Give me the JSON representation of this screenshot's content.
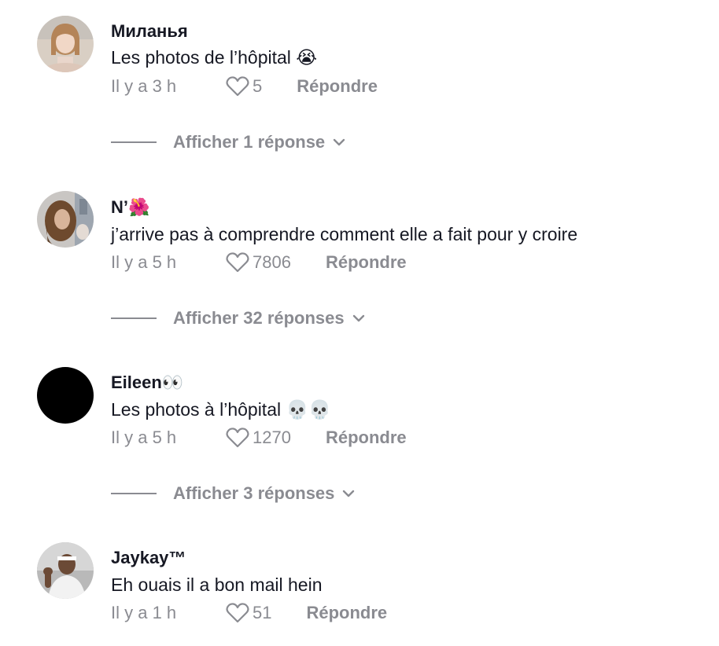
{
  "comments": [
    {
      "username": "Миланья",
      "text": "Les photos de l’hôpital",
      "emoji": "😭",
      "time": "Il y a 3 h",
      "likes": "5",
      "reply_label": "Répondre",
      "replies_label": "Afficher 1 réponse"
    },
    {
      "username": "N’",
      "username_emoji": "🌺",
      "text": "j’arrive pas à comprendre comment elle a fait pour y croire",
      "time": "Il y a 5 h",
      "likes": "7806",
      "reply_label": "Répondre",
      "replies_label": "Afficher 32 réponses"
    },
    {
      "username": "Eileen",
      "username_emoji": "👀",
      "text": "Les photos à l’hôpital",
      "emoji": "💀💀",
      "time": "Il y a 5 h",
      "likes": "1270",
      "reply_label": "Répondre",
      "replies_label": "Afficher 3 réponses"
    },
    {
      "username": "Jaykay™",
      "text": "Eh ouais il a bon mail hein",
      "time": "Il y a 1 h",
      "likes": "51",
      "reply_label": "Répondre"
    }
  ],
  "colors": {
    "text": "#161823",
    "secondary": "#8a8b91",
    "background": "#ffffff"
  },
  "icons": {
    "like": "heart-outline-icon",
    "expand": "chevron-down-icon"
  }
}
